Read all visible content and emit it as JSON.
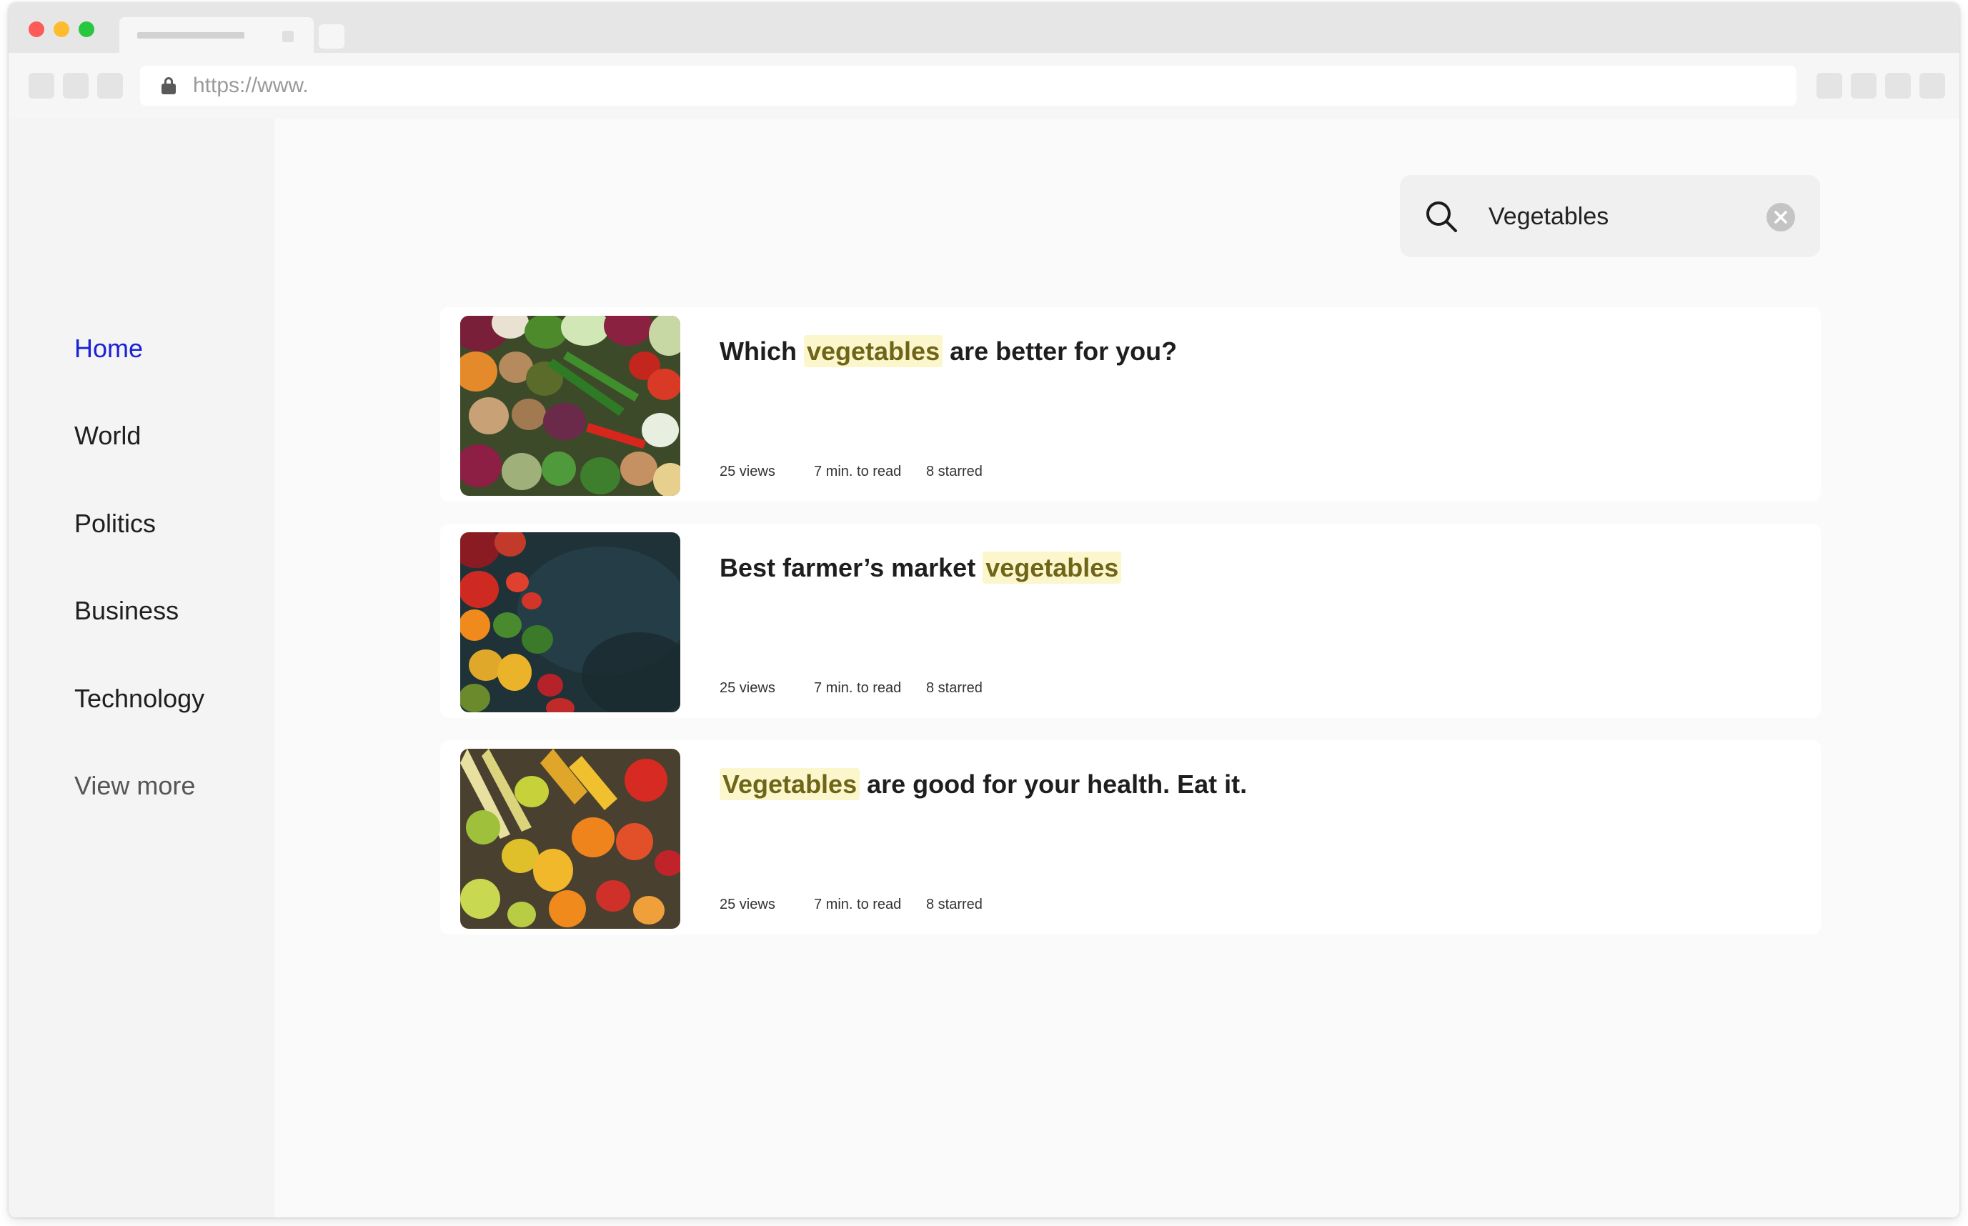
{
  "browser": {
    "url": "https://www."
  },
  "sidebar": {
    "items": [
      {
        "label": "Home",
        "active": true
      },
      {
        "label": "World"
      },
      {
        "label": "Politics"
      },
      {
        "label": "Business"
      },
      {
        "label": "Technology"
      },
      {
        "label": "View more"
      }
    ]
  },
  "search": {
    "value": "Vegetables",
    "icon": "search-icon",
    "clear_icon": "clear-icon"
  },
  "results": [
    {
      "title_before": "Which ",
      "title_highlight": "vegetables",
      "title_after": " are better for you?",
      "views": "25 views",
      "read_time": "7 min. to read",
      "starred": "8 starred"
    },
    {
      "title_before": "Best farmer’s market ",
      "title_highlight": "vegetables",
      "title_after": "",
      "views": "25 views",
      "read_time": "7 min. to read",
      "starred": "8 starred"
    },
    {
      "title_before": "",
      "title_highlight": "Vegetables",
      "title_after": " are good for your health. Eat it.",
      "views": "25 views",
      "read_time": "7 min. to read",
      "starred": "8 starred"
    }
  ],
  "colors": {
    "active_nav": "#1a22d6",
    "highlight_bg": "#fbf6cc",
    "highlight_text": "#6e6518"
  }
}
